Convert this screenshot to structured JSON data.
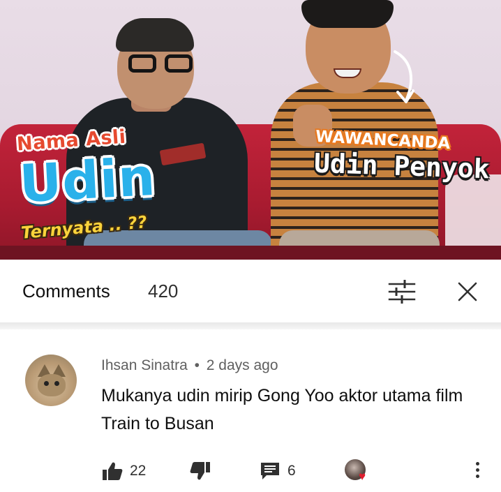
{
  "thumbnail": {
    "overlay_left_top": "Nama Asli",
    "overlay_left_main": "Udin",
    "overlay_left_bottom": "Ternyata .. ??",
    "overlay_right_top": "WAWANCANDA",
    "overlay_right_main": "Udin Penyok"
  },
  "comments_header": {
    "title": "Comments",
    "count": "420",
    "sort_icon": "sort-sliders-icon",
    "close_icon": "close-x-icon"
  },
  "comment": {
    "author": "Ihsan Sinatra",
    "separator": "•",
    "time": "2 days ago",
    "text": "Mukanya udin mirip Gong Yoo aktor utama film Train to Busan",
    "likes": "22",
    "replies": "6",
    "creator_heart_color": "#e01e2f"
  },
  "colors": {
    "udin_blue": "#2ab1ea",
    "nama_red": "#e6492f",
    "ternyata_yellow": "#fbd33b",
    "wawan_orange": "#e8791f"
  }
}
